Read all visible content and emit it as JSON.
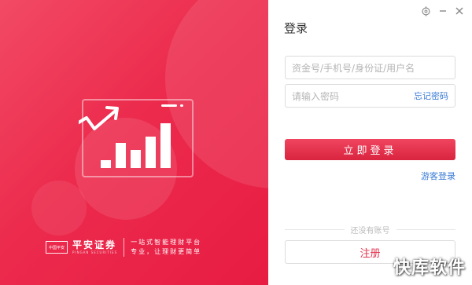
{
  "window": {
    "settings_icon": "gear-icon",
    "minimize_icon": "minimize-icon",
    "close_icon": "close-icon"
  },
  "brand": {
    "logo_text": "中国平安",
    "name": "平安证券",
    "name_en": "PINGAN SECURITIES",
    "slogan_line1": "一站式智能理财平台",
    "slogan_line2": "专业，让理财更简单"
  },
  "login": {
    "title": "登录",
    "account_placeholder": "资金号/手机号/身份证/用户名",
    "password_placeholder": "请输入密码",
    "forgot_password": "忘记密码",
    "login_button": "立即登录",
    "guest_login": "游客登录",
    "no_account_text": "还没有账号",
    "register_button": "注册"
  },
  "colors": {
    "brand_red": "#e81c43",
    "link_blue": "#3a7bd5"
  },
  "watermark": "快库软件"
}
